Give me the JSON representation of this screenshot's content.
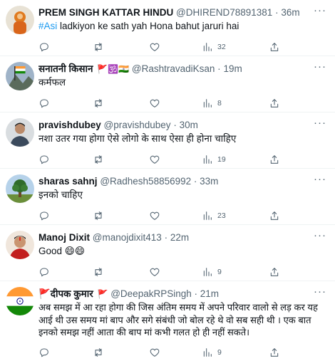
{
  "tweets": [
    {
      "name": "PREM SINGH KATTAR HINDU",
      "badges": "",
      "handle": "@DHIREND78891381",
      "dot": "·",
      "time": "36m",
      "hashtag": "#Asi",
      "text": " ladkiyon ke sath yah Hona bahut jaruri hai",
      "views": "32",
      "avatar_icon": "saffron-deity-avatar-icon"
    },
    {
      "name": "सनातनी किसान",
      "badges": "🚩🕉️🇮🇳",
      "handle": "@RashtravadiKsan",
      "dot": "·",
      "time": "19m",
      "hashtag": "",
      "text": "कर्मफल",
      "views": "8",
      "avatar_icon": "flag-mountain-avatar-icon"
    },
    {
      "name": "pravishdubey",
      "badges": "",
      "handle": "@pravishdubey",
      "dot": "·",
      "time": "30m",
      "hashtag": "",
      "text": "नशा उतर गया होगा ऐसे लोगो के साथ ऐसा ही होना चाहिए",
      "views": "19",
      "avatar_icon": "person-photo-avatar-icon"
    },
    {
      "name": "sharas sahnj",
      "badges": "",
      "handle": "@Radhesh58856992",
      "dot": "·",
      "time": "33m",
      "hashtag": "",
      "text": "इनको चाहिए",
      "views": "23",
      "avatar_icon": "tree-landscape-avatar-icon"
    },
    {
      "name": "Manoj Dixit",
      "badges": "",
      "handle": "@manojdixit413",
      "dot": "·",
      "time": "22m",
      "hashtag": "",
      "text": "Good 😄😄",
      "views": "9",
      "avatar_icon": "man-tilak-avatar-icon"
    },
    {
      "name": "🚩दीपक कुमार",
      "badges": "🚩",
      "handle": "@DeepakRPSingh",
      "dot": "·",
      "time": "21m",
      "hashtag": "",
      "text": "अब समझ में आ रहा होगा की जिस अंतिम समय में अपने परिवार वालो से लड़ कर यह आई थी उस समय मां बाप और सगे संबंधी जो बोल रहे थे वो सब सही थी । एक बात इनको समझ नहीं आता की बाप मां कभी गलत हो ही नहीं सकते।",
      "views": "9",
      "avatar_icon": "india-flag-avatar-icon"
    }
  ],
  "more_label": "···",
  "colors": {
    "link": "#1d9bf0",
    "secondary": "#536471",
    "divider": "#eff3f4"
  }
}
